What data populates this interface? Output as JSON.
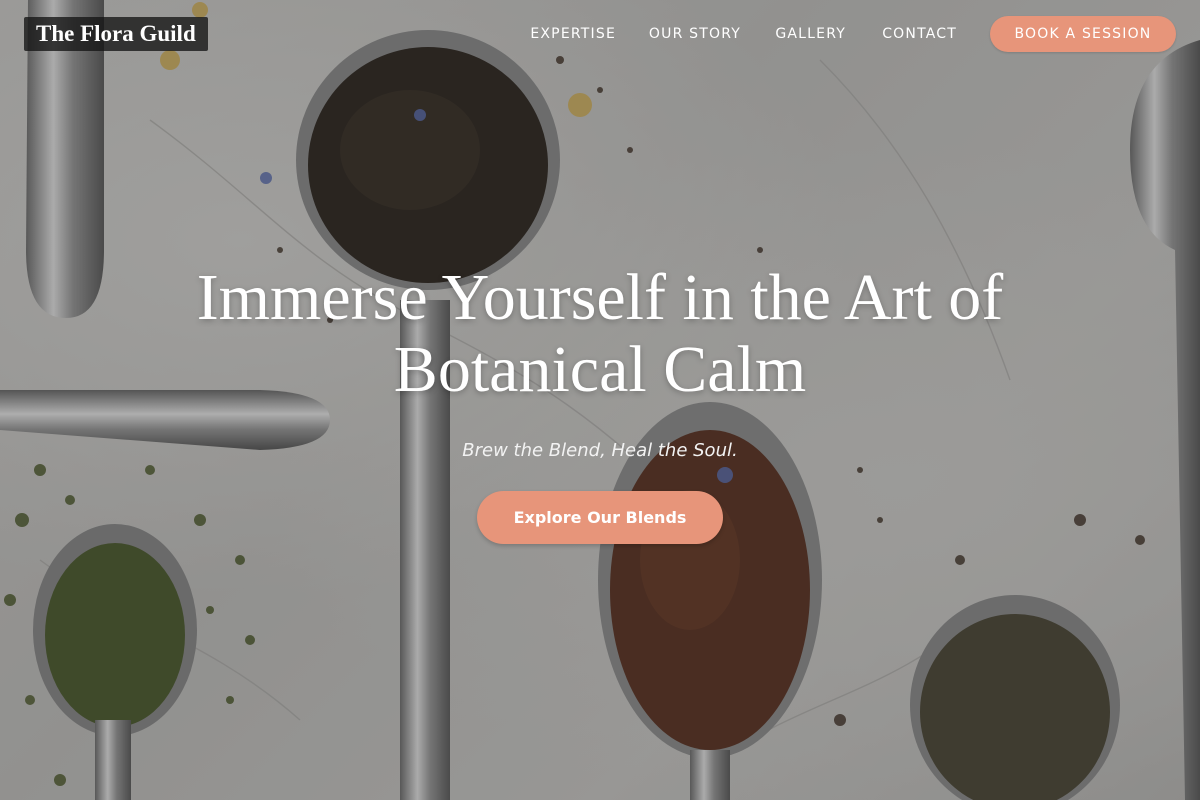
{
  "brand": {
    "name": "The Flora Guild"
  },
  "nav": {
    "items": [
      {
        "label": "EXPERTISE"
      },
      {
        "label": "OUR STORY"
      },
      {
        "label": "GALLERY"
      },
      {
        "label": "CONTACT"
      }
    ],
    "cta_label": "BOOK A SESSION"
  },
  "hero": {
    "title": "Immerse Yourself in the Art of Botanical Calm",
    "tagline": "Brew the Blend, Heal the Soul.",
    "cta_label": "Explore Our Blends",
    "background": "tea-leaves-on-spoons-photo"
  },
  "colors": {
    "accent": "#e7957a",
    "logo_bg": "#1a1a1a",
    "text": "#ffffff"
  }
}
